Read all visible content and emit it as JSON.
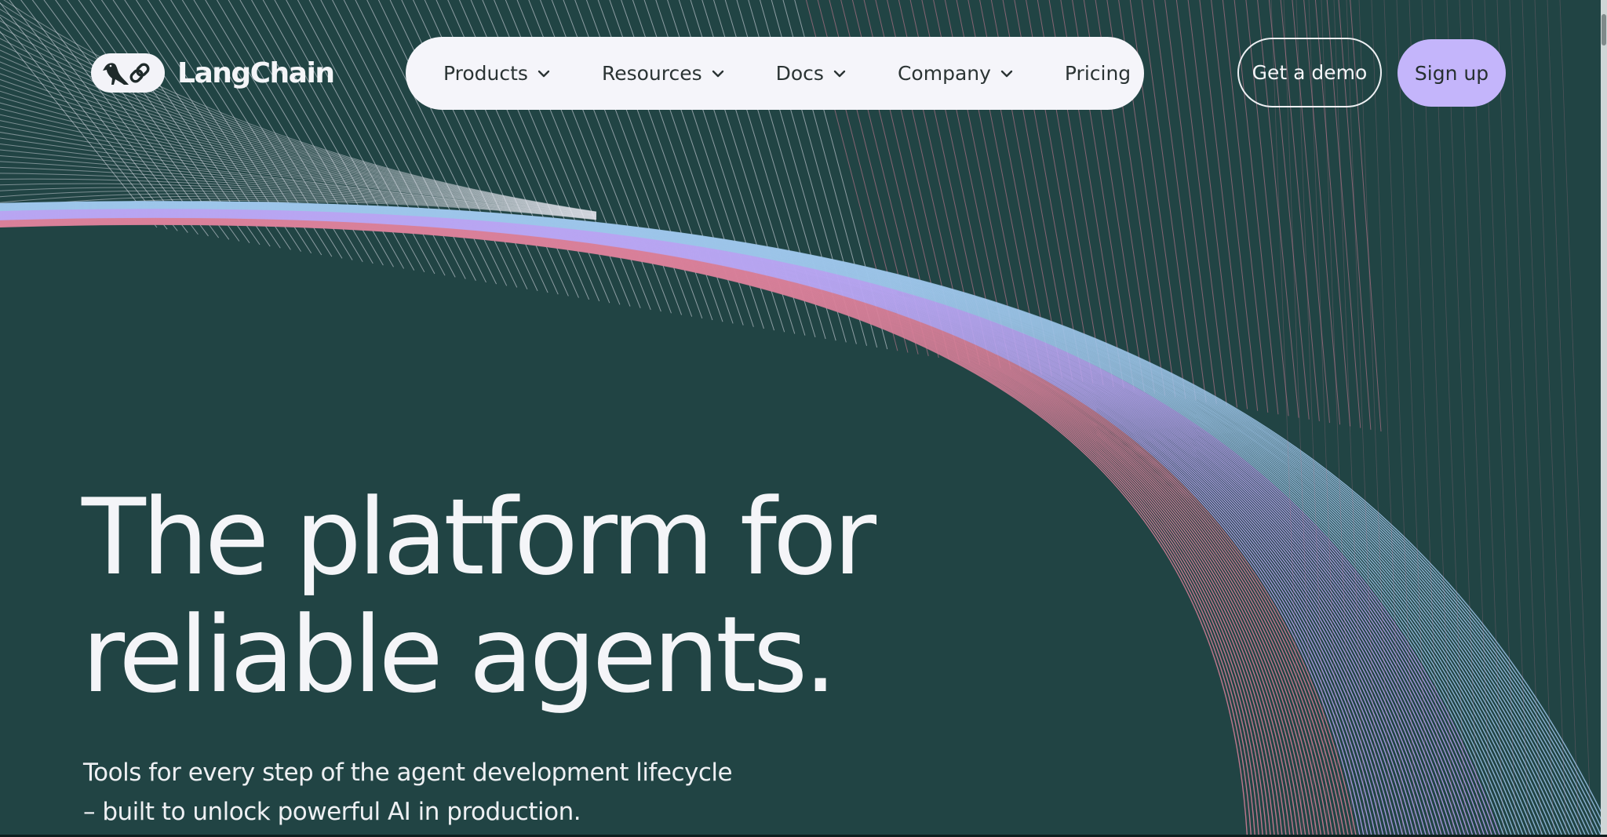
{
  "brand": {
    "name": "LangChain"
  },
  "nav": {
    "items": [
      {
        "label": "Products",
        "has_dropdown": true
      },
      {
        "label": "Resources",
        "has_dropdown": true
      },
      {
        "label": "Docs",
        "has_dropdown": true
      },
      {
        "label": "Company",
        "has_dropdown": true
      },
      {
        "label": "Pricing",
        "has_dropdown": false
      }
    ]
  },
  "actions": {
    "demo_label": "Get a demo",
    "signup_label": "Sign up"
  },
  "hero": {
    "headline_line1": "The platform for",
    "headline_line2": "reliable agents.",
    "subtitle_line1": "Tools for every step of the agent development lifecycle",
    "subtitle_line2": "– built to unlock powerful AI in production."
  },
  "icons": {
    "logo": "parrot-and-chain-link-icon",
    "dropdown": "chevron-down-icon"
  },
  "colors": {
    "background": "#214444",
    "nav_background": "#f5f5fa",
    "signup_button": "#c4b5fb",
    "text_light": "#f4f5f8",
    "text_dark": "#2b3434",
    "line_lavender": "#b8a6f2",
    "line_pink": "#d9809a",
    "line_blue": "#9ec6ea"
  }
}
